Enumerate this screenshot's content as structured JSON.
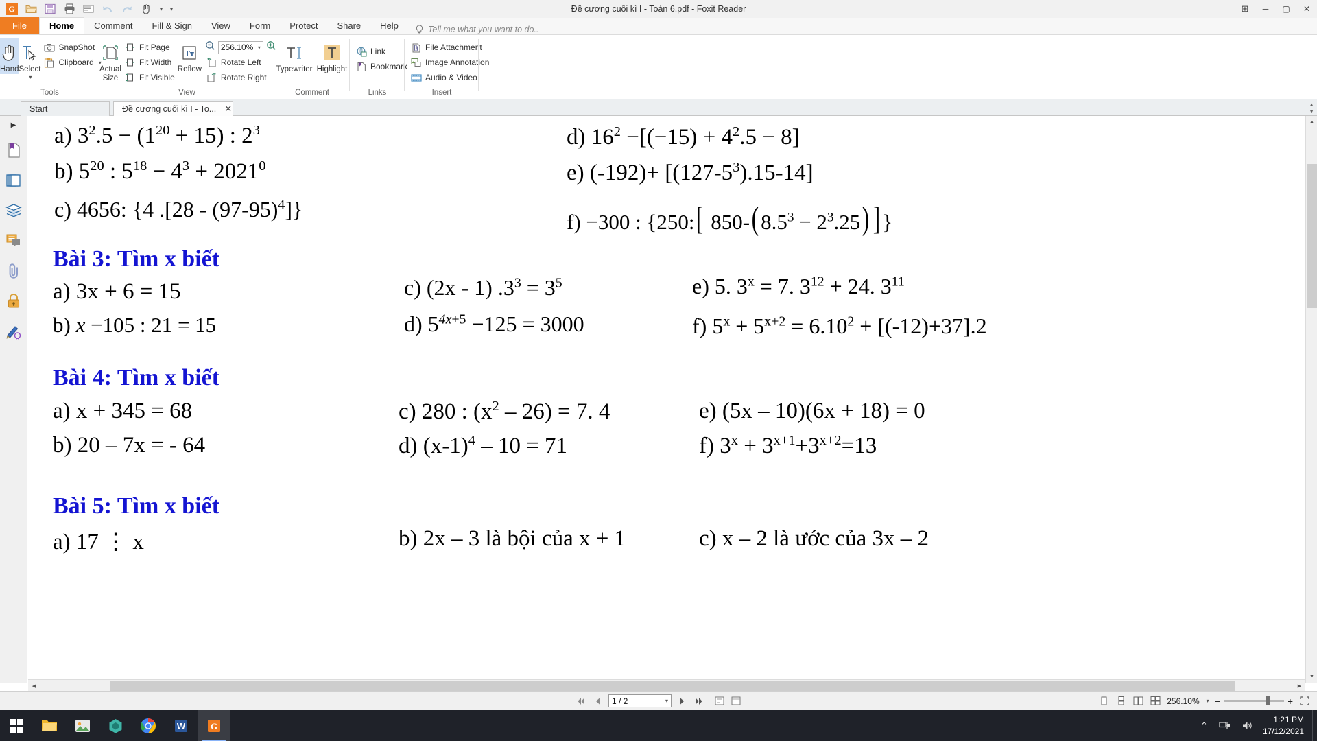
{
  "window": {
    "title": "Đề cương cuối kì I - Toán 6.pdf - Foxit Reader",
    "minimize": "─",
    "maximize": "▢",
    "close": "✕",
    "grid_icon": "⊞"
  },
  "quick_access": {
    "logo": "G",
    "items": [
      {
        "name": "open-icon",
        "glyph": "📂"
      },
      {
        "name": "save-icon",
        "glyph": "💾"
      },
      {
        "name": "print-icon",
        "glyph": "🖨"
      },
      {
        "name": "email-icon",
        "glyph": "✉"
      },
      {
        "name": "undo-icon",
        "glyph": "↺"
      },
      {
        "name": "redo-icon",
        "glyph": "↻"
      },
      {
        "name": "hand-tool-icon",
        "glyph": "✋"
      },
      {
        "name": "customize-icon",
        "glyph": "▾"
      }
    ]
  },
  "ribbon_tabs": [
    {
      "label": "File",
      "active": false,
      "kind": "file"
    },
    {
      "label": "Home",
      "active": true,
      "kind": "normal"
    },
    {
      "label": "Comment",
      "active": false,
      "kind": "normal"
    },
    {
      "label": "Fill & Sign",
      "active": false,
      "kind": "normal"
    },
    {
      "label": "View",
      "active": false,
      "kind": "normal"
    },
    {
      "label": "Form",
      "active": false,
      "kind": "normal"
    },
    {
      "label": "Protect",
      "active": false,
      "kind": "normal"
    },
    {
      "label": "Share",
      "active": false,
      "kind": "normal"
    },
    {
      "label": "Help",
      "active": false,
      "kind": "normal"
    }
  ],
  "tell_me": {
    "placeholder": "Tell me what you want to do..",
    "icon": "bulb-icon"
  },
  "ribbon": {
    "groups": [
      {
        "label": "Tools",
        "big": [
          {
            "label": "Hand",
            "icon": "hand-icon",
            "selected": true
          },
          {
            "label": "Select",
            "icon": "select-icon",
            "selected": false,
            "caret": "▾"
          }
        ],
        "small": [
          {
            "label": "SnapShot",
            "icon": "camera-icon",
            "caret": ""
          },
          {
            "label": "Clipboard",
            "icon": "clipboard-icon",
            "caret": "▾"
          }
        ]
      },
      {
        "label": "View",
        "big": [
          {
            "label": "Actual Size",
            "icon": "actual-size-icon",
            "selected": false
          }
        ],
        "small": [
          {
            "label": "Fit Page",
            "icon": "fit-page-icon",
            "caret": ""
          },
          {
            "label": "Fit Width",
            "icon": "fit-width-icon",
            "caret": ""
          },
          {
            "label": "Fit Visible",
            "icon": "fit-visible-icon",
            "caret": ""
          }
        ],
        "big2": [
          {
            "label": "Reflow",
            "icon": "reflow-icon",
            "selected": false
          }
        ],
        "zoom": {
          "value": "256.10%",
          "caret": "▾",
          "zoom_out_icon": "zoom-out-icon",
          "zoom_in_icon": "zoom-in-icon"
        },
        "small2": [
          {
            "label": "Rotate Left",
            "icon": "rotate-left-icon",
            "caret": ""
          },
          {
            "label": "Rotate Right",
            "icon": "rotate-right-icon",
            "caret": ""
          }
        ]
      },
      {
        "label": "Comment",
        "big": [
          {
            "label": "Typewriter",
            "icon": "typewriter-icon",
            "selected": false
          },
          {
            "label": "Highlight",
            "icon": "highlight-icon",
            "selected": false
          }
        ]
      },
      {
        "label": "Links",
        "small": [
          {
            "label": "Link",
            "icon": "link-icon",
            "caret": ""
          },
          {
            "label": "Bookmark",
            "icon": "bookmark-icon",
            "caret": ""
          }
        ]
      },
      {
        "label": "Insert",
        "small": [
          {
            "label": "File Attachment",
            "icon": "file-attachment-icon",
            "caret": ""
          },
          {
            "label": "Image Annotation",
            "icon": "image-annotation-icon",
            "caret": ""
          },
          {
            "label": "Audio & Video",
            "icon": "audio-video-icon",
            "caret": ""
          }
        ]
      }
    ]
  },
  "doc_tabs": [
    {
      "label": "Start",
      "closable": false,
      "active": false
    },
    {
      "label": "Đề cương cuối kì I - To...",
      "closable": true,
      "close_glyph": "✕",
      "active": true
    }
  ],
  "nav_pane": {
    "expand_glyph": "▶",
    "icons": [
      {
        "name": "bookmarks-icon"
      },
      {
        "name": "page-thumbnails-icon"
      },
      {
        "name": "layers-icon"
      },
      {
        "name": "comments-icon"
      },
      {
        "name": "attachments-icon"
      },
      {
        "name": "security-icon"
      },
      {
        "name": "signatures-icon"
      }
    ]
  },
  "document": {
    "bai2": {
      "left": [
        {
          "id": "a",
          "html": "a)  3<sup>2</sup>.5 − (1<sup>20</sup> + 15) : 2<sup>3</sup>"
        },
        {
          "id": "b",
          "html": "b)  5<sup>20</sup> : 5<sup>18</sup> − 4<sup>3</sup> + 2021<sup>0</sup>"
        },
        {
          "id": "c",
          "html": "c) 4656: {4 .[28 - (97-95)<sup>4</sup>]}"
        }
      ],
      "right": [
        {
          "id": "d",
          "html": "d)  16<sup>2</sup> −[(−15) + 4<sup>2</sup>.5 − 8]"
        },
        {
          "id": "e",
          "html": "e) (-192)+ [(127-5<sup>3</sup>).15-14]"
        },
        {
          "id": "f",
          "html": "f)  −300 : {250:<span class=\"bigbr\">[</span> 850-<span class=\"bigbr\">(</span>8.5<sup>3</sup> − 2<sup>3</sup>.25<span class=\"bigbr\">)</span><span class=\"bigbr\">]</span>}"
        }
      ]
    },
    "bai3": {
      "title": "Bài 3: Tìm x biết",
      "col1": [
        {
          "id": "a",
          "html": "a) 3x + 6 = 15"
        },
        {
          "id": "b",
          "html": "b)  <i>x</i> −105 : 21 = 15"
        }
      ],
      "col2": [
        {
          "id": "c",
          "html": "c) (2x - 1) .3<sup>3</sup> = 3<sup>5</sup>"
        },
        {
          "id": "d",
          "html": "d)  5<sup><i>4x</i>+5</sup> −125 = 3000"
        }
      ],
      "col3": [
        {
          "id": "e",
          "html": "e) 5. 3<sup>x</sup> = 7. 3<sup>12</sup> + 24. 3<sup>11</sup>"
        },
        {
          "id": "f",
          "html": "f) 5<sup>x</sup> + 5<sup>x+2</sup> = 6.10<sup>2</sup> + [(-12)+37].2"
        }
      ]
    },
    "bai4": {
      "title": "Bài 4: Tìm x biết",
      "col1": [
        {
          "id": "a",
          "html": "a) x  + 345 = 68"
        },
        {
          "id": "b",
          "html": "b) 20 – 7x = - 64"
        }
      ],
      "col2": [
        {
          "id": "c",
          "html": "c) 280 : (x<sup>2</sup> – 26) = 7. 4"
        },
        {
          "id": "d",
          "html": "d) (x-1)<sup>4</sup> – 10 = 71"
        }
      ],
      "col3": [
        {
          "id": "e",
          "html": "e) (5x – 10)(6x + 18) = 0"
        },
        {
          "id": "f",
          "html": "f) 3<sup>x</sup> + 3<sup>x+1</sup>+3<sup>x+2</sup>=13"
        }
      ]
    },
    "bai5": {
      "title": "Bài 5: Tìm x biết",
      "col1": [
        {
          "id": "a",
          "html": "a) 17 ⋮ x"
        }
      ],
      "col2": [
        {
          "id": "b",
          "html": "b) 2x – 3 là bội của x + 1"
        }
      ],
      "col3": [
        {
          "id": "c",
          "html": "c) x – 2  là ước của 3x – 2"
        }
      ]
    }
  },
  "status_bar": {
    "first_page_icon": "first-page-icon",
    "prev_page_icon": "prev-page-icon",
    "page_value": "1 / 2",
    "page_caret": "▾",
    "next_page_icon": "next-page-icon",
    "last_page_icon": "last-page-icon",
    "fit_icon_1": "fit-page-icon",
    "fit_icon_2": "fit-width-icon",
    "view_modes": [
      {
        "name": "single-page-view-icon"
      },
      {
        "name": "continuous-view-icon"
      },
      {
        "name": "facing-view-icon"
      },
      {
        "name": "continuous-facing-view-icon"
      }
    ],
    "zoom_label": "256.10%",
    "zoom_caret": "▾",
    "zoom_out": "−",
    "zoom_in": "+",
    "fullscreen_icon": "fullscreen-icon"
  },
  "taskbar": {
    "start_icon": "windows-start-icon",
    "items": [
      {
        "name": "file-explorer-icon",
        "active": false
      },
      {
        "name": "photos-icon",
        "active": false
      },
      {
        "name": "app-icon",
        "active": false
      },
      {
        "name": "chrome-icon",
        "active": false
      },
      {
        "name": "word-icon",
        "active": false
      },
      {
        "name": "foxit-reader-icon",
        "active": true
      }
    ],
    "tray": {
      "chevron": "⌃",
      "network_icon": "network-icon",
      "volume_icon": "volume-icon",
      "time": "1:21 PM",
      "date": "17/12/2021"
    }
  }
}
